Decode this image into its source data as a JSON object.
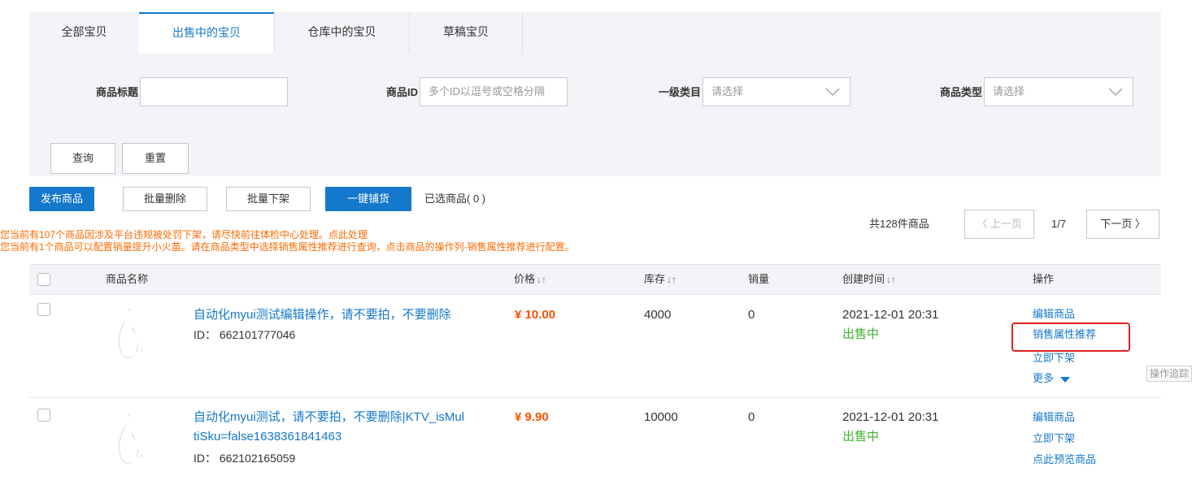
{
  "tabs": [
    {
      "label": "全部宝贝",
      "active": false
    },
    {
      "label": "出售中的宝贝",
      "active": true
    },
    {
      "label": "仓库中的宝贝",
      "active": false
    },
    {
      "label": "草稿宝贝",
      "active": false
    }
  ],
  "filters": {
    "title_label": "商品标题",
    "title_value": "",
    "id_label": "商品ID",
    "id_placeholder": "多个ID以逗号或空格分隔",
    "category_label": "一级类目",
    "category_value": "请选择",
    "type_label": "商品类型",
    "type_value": "请选择",
    "query_button": "查询",
    "reset_button": "重置"
  },
  "actions": {
    "publish": "发布商品",
    "batch_delete": "批量删除",
    "batch_offshelf": "批量下架",
    "one_click": "一键铺货",
    "selected": "已选商品( 0 )"
  },
  "notices": {
    "line1_text": "您当前有107个商品因涉及平台违规被处罚下架，请尽快前往体检中心处理。",
    "line1_link": "点此处理",
    "line2_text": "您当前有1个商品可以配置销量提升小火苗。请在商品类型中选择销售属性推荐进行查询，点击商品的操作列-销售属性推荐进行配置。"
  },
  "pagination": {
    "total": "共128件商品",
    "prev": "〈 上一页",
    "current": "1/7",
    "next": "下一页 〉"
  },
  "table": {
    "headers": {
      "name": "商品名称",
      "price": "价格",
      "stock": "库存",
      "sales": "销量",
      "created": "创建时间",
      "ops": "操作"
    },
    "sort_icon": "↓↑",
    "rows": [
      {
        "name": "自动化myui测试编辑操作，请不要拍，不要删除",
        "name_line2": "",
        "id": "ID：  662101777046",
        "price": "¥ 10.00",
        "stock": "4000",
        "sales": "0",
        "created": "2021-12-01 20:31",
        "status": "出售中",
        "ops": [
          "编辑商品",
          "销售属性推荐",
          "立即下架"
        ],
        "more": "更多"
      },
      {
        "name": "自动化myui测试，请不要拍，不要删除|KTV_isMul",
        "name_line2": "tiSku=false1638361841463",
        "id": "ID：  662102165059",
        "price": "¥ 9.90",
        "stock": "10000",
        "sales": "0",
        "created": "2021-12-01 20:31",
        "status": "出售中",
        "ops": [
          "编辑商品",
          "立即下架",
          "点此预览商品"
        ],
        "more": ""
      }
    ]
  },
  "trace_label": "操作追踪",
  "colors": {
    "accent": "#1478cc",
    "price": "#ff5000",
    "status": "#3cb52e",
    "notice": "#ff6a00",
    "highlight": "#e02020"
  }
}
